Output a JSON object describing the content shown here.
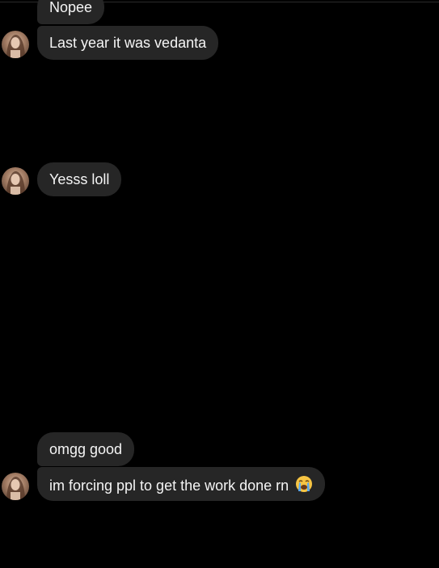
{
  "conversation": {
    "messages": [
      {
        "text": "Nopee"
      },
      {
        "text": "Last year it was vedanta"
      },
      {
        "text": "Yesss loll"
      },
      {
        "text": "omgg good"
      },
      {
        "text": "im forcing ppl to get the work done rn",
        "emoji": "😭"
      }
    ]
  },
  "colors": {
    "background": "#000000",
    "bubble": "#262626",
    "text": "#f5f5f5"
  },
  "icons": {
    "avatar": "profile-photo-avatar",
    "emoji": "loudly-crying-face-emoji"
  }
}
